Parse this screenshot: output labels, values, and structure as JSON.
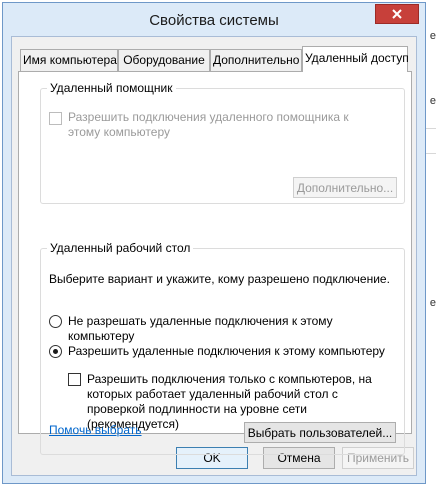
{
  "window": {
    "title": "Свойства системы"
  },
  "tabs": [
    {
      "label": "Имя компьютера",
      "active": false
    },
    {
      "label": "Оборудование",
      "active": false
    },
    {
      "label": "Дополнительно",
      "active": false
    },
    {
      "label": "Удаленный доступ",
      "active": true
    }
  ],
  "remote_assistance": {
    "legend": "Удаленный помощник",
    "checkbox_label": "Разрешить подключения удаленного помощника к этому компьютеру",
    "checked": false,
    "enabled": false,
    "advanced_button": "Дополнительно..."
  },
  "remote_desktop": {
    "legend": "Удаленный рабочий стол",
    "instruction": "Выберите вариант и укажите, кому разрешено подключение.",
    "options": [
      {
        "label": "Не разрешать удаленные подключения к этому компьютеру",
        "selected": false
      },
      {
        "label": "Разрешить удаленные подключения к этому компьютеру",
        "selected": true
      }
    ],
    "nla_checkbox_label": "Разрешить подключения только с компьютеров, на которых работает удаленный рабочий стол с проверкой подлинности на уровне сети (рекомендуется)",
    "nla_checked": false,
    "help_link": "Помочь выбрать",
    "select_users_button": "Выбрать пользователей..."
  },
  "footer": {
    "ok": "OK",
    "cancel": "Отмена",
    "apply": "Применить"
  },
  "colors": {
    "frame": "#dceaf8",
    "close_button": "#c7403a",
    "link": "#0066cc"
  },
  "background_window": {
    "chars": [
      "е",
      "е",
      "е"
    ]
  }
}
